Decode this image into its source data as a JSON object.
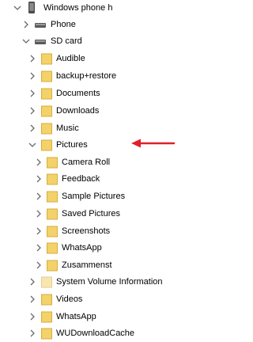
{
  "colors": {
    "folder": "#f4d26a",
    "folder_edge": "#d7ae3e",
    "folder_light": "#f8e6b2",
    "chevron": "#6b6b6b",
    "device": "#4a4a4a",
    "arrow": "#e0202a"
  },
  "tree": [
    {
      "label": "Windows phone h",
      "icon": "phone-icon",
      "chevron": "down",
      "depth": 0
    },
    {
      "label": "Phone",
      "icon": "drive-icon",
      "chevron": "right",
      "depth": 1
    },
    {
      "label": "SD card",
      "icon": "drive-icon",
      "chevron": "down",
      "depth": 1
    },
    {
      "label": "Audible",
      "icon": "folder-icon",
      "chevron": "right",
      "depth": 2
    },
    {
      "label": "backup+restore",
      "icon": "folder-icon",
      "chevron": "right",
      "depth": 2
    },
    {
      "label": "Documents",
      "icon": "folder-icon",
      "chevron": "right",
      "depth": 2
    },
    {
      "label": "Downloads",
      "icon": "folder-icon",
      "chevron": "right",
      "depth": 2
    },
    {
      "label": "Music",
      "icon": "folder-icon",
      "chevron": "right",
      "depth": 2
    },
    {
      "label": "Pictures",
      "icon": "folder-icon",
      "chevron": "down",
      "depth": 2
    },
    {
      "label": "Camera Roll",
      "icon": "folder-icon",
      "chevron": "right",
      "depth": 3
    },
    {
      "label": "Feedback",
      "icon": "folder-icon",
      "chevron": "right",
      "depth": 3
    },
    {
      "label": "Sample Pictures",
      "icon": "folder-icon",
      "chevron": "right",
      "depth": 3
    },
    {
      "label": "Saved Pictures",
      "icon": "folder-icon",
      "chevron": "right",
      "depth": 3
    },
    {
      "label": "Screenshots",
      "icon": "folder-icon",
      "chevron": "right",
      "depth": 3
    },
    {
      "label": "WhatsApp",
      "icon": "folder-icon",
      "chevron": "right",
      "depth": 3
    },
    {
      "label": "Zusammenst",
      "icon": "folder-icon",
      "chevron": "right",
      "depth": 3
    },
    {
      "label": "System Volume Information",
      "icon": "folder-light-icon",
      "chevron": "right",
      "depth": 2
    },
    {
      "label": "Videos",
      "icon": "folder-icon",
      "chevron": "right",
      "depth": 2
    },
    {
      "label": "WhatsApp",
      "icon": "folder-icon",
      "chevron": "right",
      "depth": 2
    },
    {
      "label": "WUDownloadCache",
      "icon": "folder-icon",
      "chevron": "right",
      "depth": 2
    }
  ]
}
